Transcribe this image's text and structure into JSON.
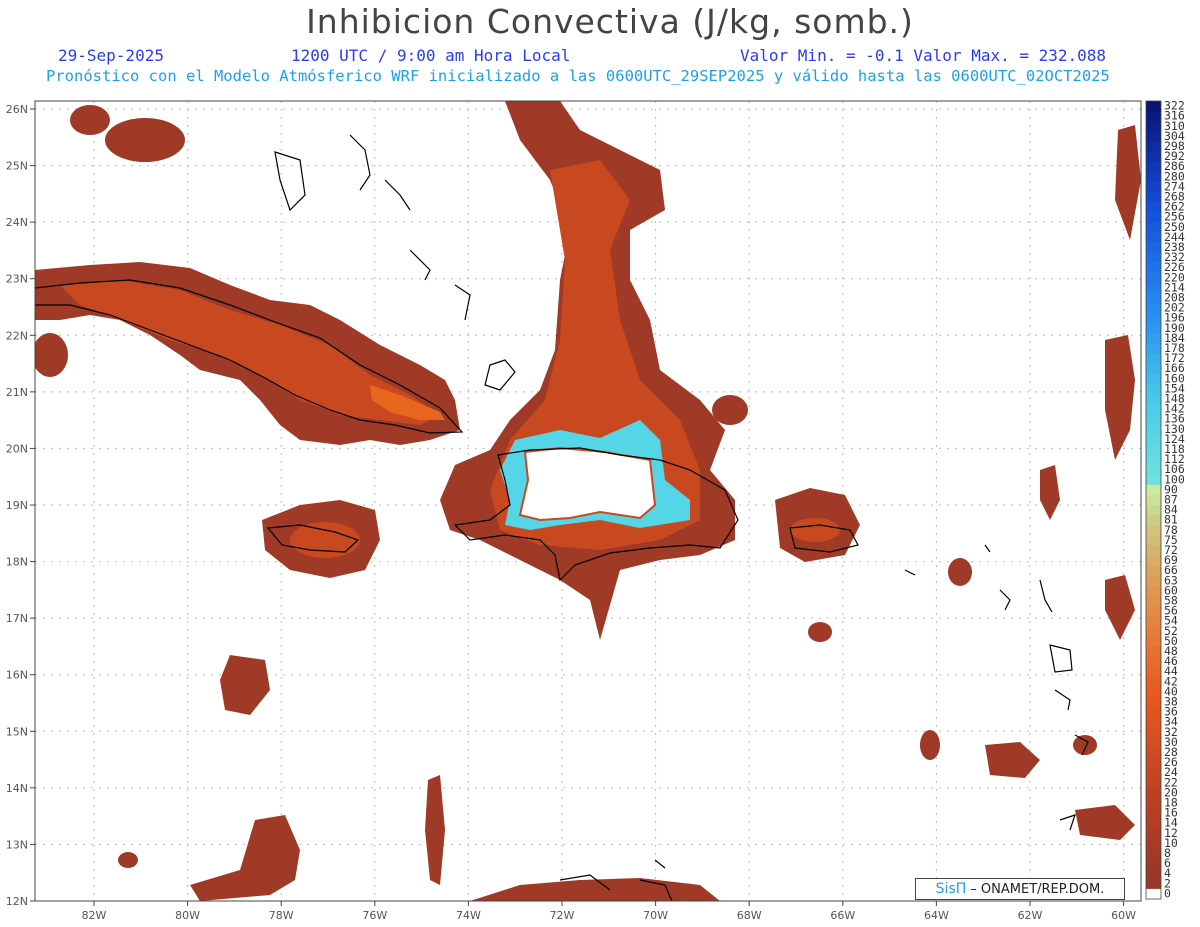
{
  "header": {
    "title": "Inhibicion Convectiva (J/kg, somb.)",
    "date": "29-Sep-2025",
    "time": "1200 UTC / 9:00 am Hora Local",
    "minmax": "Valor Min. = -0.1  Valor Max. = 232.088",
    "model_line": "Pronóstico con el Modelo Atmósferico WRF inicializado a las 0600UTC_29SEP2025 y válido hasta las  0600UTC_02OCT2025"
  },
  "map": {
    "lat_labels": [
      "12N",
      "13N",
      "14N",
      "15N",
      "16N",
      "17N",
      "18N",
      "19N",
      "20N",
      "21N",
      "22N",
      "23N",
      "24N",
      "25N",
      "26N"
    ],
    "lon_labels": [
      "82W",
      "80W",
      "78W",
      "76W",
      "74W",
      "72W",
      "70W",
      "68W",
      "66W",
      "64W",
      "62W",
      "60W"
    ],
    "colors": {
      "field_dark": "#9e3a26",
      "field_mid": "#c8481f",
      "field_orange": "#e8661e",
      "field_cyan": "#55d6e6",
      "coast": "#000000",
      "grid": "#bbbbbb"
    }
  },
  "colorbar": {
    "labels": [
      "322",
      "316",
      "310",
      "304",
      "298",
      "292",
      "286",
      "280",
      "274",
      "268",
      "262",
      "256",
      "250",
      "244",
      "238",
      "232",
      "226",
      "220",
      "214",
      "208",
      "202",
      "196",
      "190",
      "184",
      "178",
      "172",
      "166",
      "160",
      "154",
      "148",
      "142",
      "136",
      "130",
      "124",
      "118",
      "112",
      "106",
      "100",
      "90",
      "87",
      "84",
      "81",
      "78",
      "75",
      "72",
      "69",
      "66",
      "63",
      "60",
      "58",
      "56",
      "54",
      "52",
      "50",
      "48",
      "46",
      "44",
      "42",
      "40",
      "38",
      "36",
      "34",
      "32",
      "30",
      "28",
      "26",
      "24",
      "22",
      "20",
      "18",
      "16",
      "14",
      "12",
      "10",
      "8",
      "6",
      "4",
      "2",
      "0"
    ]
  },
  "credit": {
    "brand": "SisΠ",
    "text": "– ONAMET/REP.DOM."
  }
}
